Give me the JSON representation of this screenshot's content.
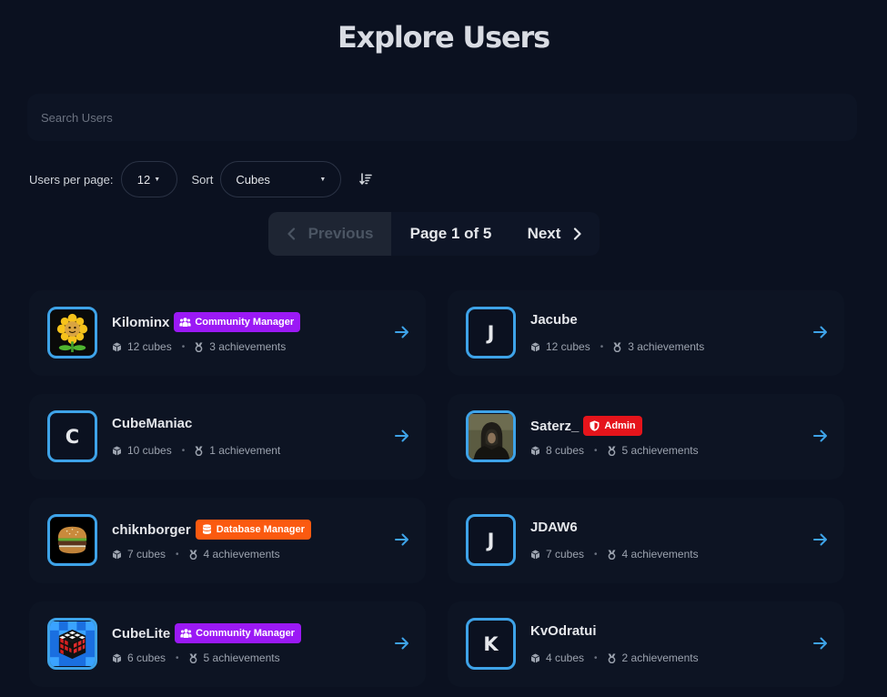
{
  "page": {
    "title": "Explore Users"
  },
  "search": {
    "placeholder": "Search Users",
    "value": ""
  },
  "controls": {
    "per_page_label": "Users per page:",
    "per_page_value": "12",
    "sort_label": "Sort",
    "sort_value": "Cubes"
  },
  "pagination": {
    "previous": "Previous",
    "page_info": "Page 1 of 5",
    "next": "Next"
  },
  "colors": {
    "accent": "#3ea3e8",
    "community_manager": "#9b19f5",
    "admin": "#e5141b",
    "database_manager": "#fb5a10"
  },
  "users": [
    {
      "username": "Kilominx",
      "avatar": "sunflower",
      "initial": "",
      "badge": "Community Manager",
      "badge_icon": "users-icon",
      "cubes": "12 cubes",
      "achievements": "3 achievements"
    },
    {
      "username": "Jacube",
      "avatar": "letter",
      "initial": "J",
      "badge": "",
      "badge_icon": "",
      "cubes": "12 cubes",
      "achievements": "3 achievements"
    },
    {
      "username": "CubeManiac",
      "avatar": "letter",
      "initial": "C",
      "badge": "",
      "badge_icon": "",
      "cubes": "10 cubes",
      "achievements": "1 achievement"
    },
    {
      "username": "Saterz_",
      "avatar": "hooded-figure",
      "initial": "",
      "badge": "Admin",
      "badge_icon": "shield-icon",
      "cubes": "8 cubes",
      "achievements": "5 achievements"
    },
    {
      "username": "chiknborger",
      "avatar": "burger",
      "initial": "",
      "badge": "Database Manager",
      "badge_icon": "database-icon",
      "cubes": "7 cubes",
      "achievements": "4 achievements"
    },
    {
      "username": "JDAW6",
      "avatar": "letter",
      "initial": "J",
      "badge": "",
      "badge_icon": "",
      "cubes": "7 cubes",
      "achievements": "4 achievements"
    },
    {
      "username": "CubeLite",
      "avatar": "rubiks-cube",
      "initial": "",
      "badge": "Community Manager",
      "badge_icon": "users-icon",
      "cubes": "6 cubes",
      "achievements": "5 achievements"
    },
    {
      "username": "KvOdratui",
      "avatar": "letter",
      "initial": "K",
      "badge": "",
      "badge_icon": "",
      "cubes": "4 cubes",
      "achievements": "2 achievements"
    }
  ]
}
